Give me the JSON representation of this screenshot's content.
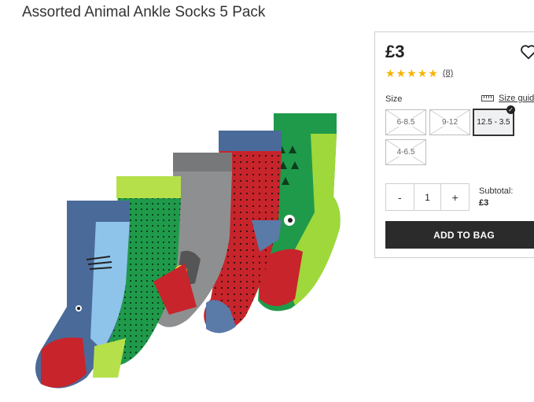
{
  "product": {
    "title": "Assorted Animal Ankle Socks 5 Pack",
    "image_icon": "socks-product-photo"
  },
  "buy_panel": {
    "price": "£3",
    "wishlist_icon": "heart-outline-icon",
    "rating": {
      "stars": 5,
      "max": 5,
      "count": "(8)",
      "star_color": "#f5b400"
    },
    "size_label": "Size",
    "size_guide_label": "Size guide",
    "size_guide_icon": "ruler-icon",
    "sizes": [
      {
        "label": "6-8.5",
        "available": false,
        "selected": false
      },
      {
        "label": "9-12",
        "available": false,
        "selected": false
      },
      {
        "label": "12.5 - 3.5",
        "available": true,
        "selected": true
      },
      {
        "label": "4-6.5",
        "available": false,
        "selected": false
      }
    ],
    "quantity": {
      "minus": "-",
      "value": "1",
      "plus": "+"
    },
    "subtotal_label": "Subtotal:",
    "subtotal_value": "£3",
    "add_to_bag": "ADD TO BAG",
    "button_color": "#2b2b2b"
  }
}
